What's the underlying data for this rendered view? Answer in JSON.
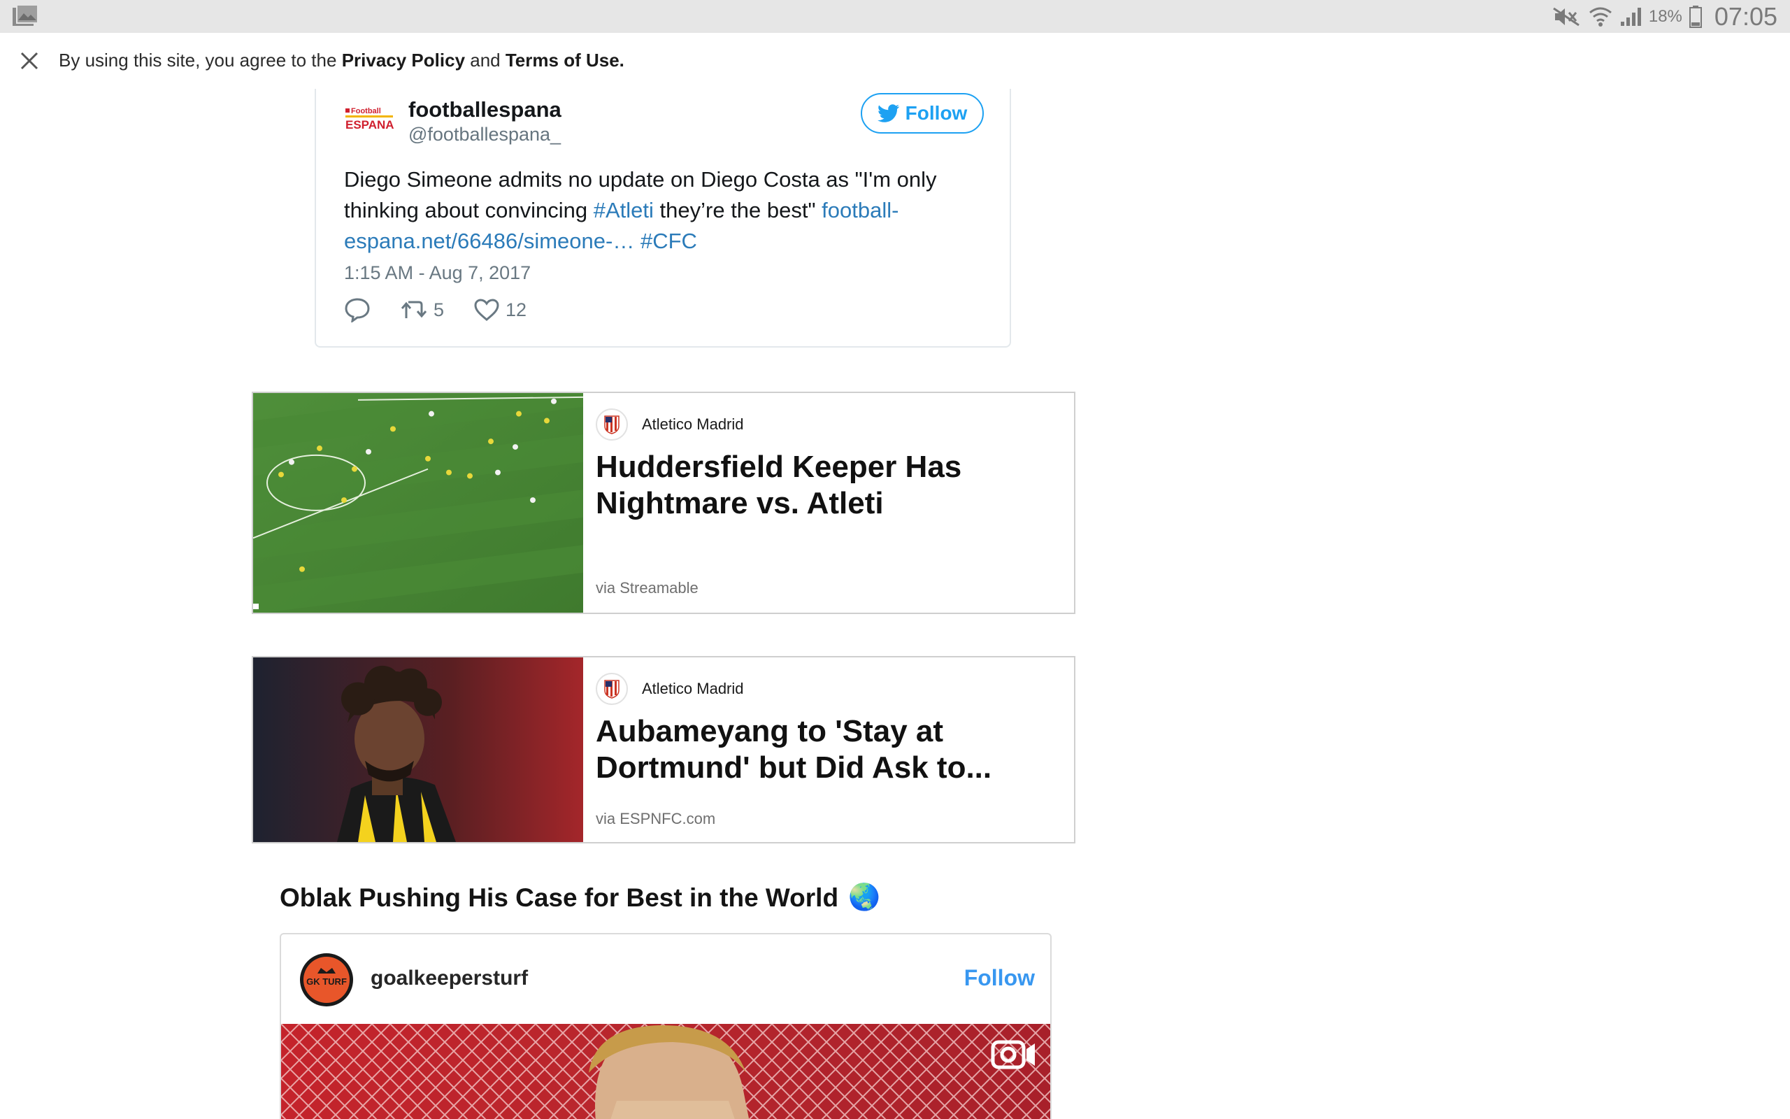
{
  "status_bar": {
    "battery": "18%",
    "time": "07:05"
  },
  "banner": {
    "prefix": "By using this site, you agree to the ",
    "privacy": "Privacy Policy",
    "and": " and ",
    "terms": "Terms of Use."
  },
  "tweet": {
    "logo_top": "Football",
    "logo_bottom": "ESPANA",
    "name": "footballespana",
    "handle": "@footballespana_",
    "follow_label": "Follow",
    "text_1": "Diego Simeone admits no update on Diego Costa as \"I'm only thinking about convincing ",
    "hashtag_1": "#Atleti",
    "text_2": " they’re the best\" ",
    "link": "football-espana.net/66486/simeone-…",
    "text_3": " ",
    "hashtag_2": "#CFC",
    "time": "1:15 AM - Aug 7, 2017",
    "retweets": "5",
    "likes": "12"
  },
  "articles": [
    {
      "source": "Atletico Madrid",
      "title": "Huddersfield Keeper Has Nightmare vs. Atleti",
      "via": "via Streamable"
    },
    {
      "source": "Atletico Madrid",
      "title": "Aubameyang to 'Stay at Dortmund' but Did Ask to...",
      "via": "via ESPNFC.com"
    }
  ],
  "section": {
    "heading": "Oblak Pushing His Case for Best in the World",
    "emoji": "🌏"
  },
  "instagram": {
    "avatar_text": "GK TURF",
    "username": "goalkeepersturf",
    "follow_label": "Follow"
  },
  "colors": {
    "twitter_blue": "#1da1f2",
    "link_blue": "#2b7bb9",
    "instagram_blue": "#3897f0",
    "status_bar_bg": "#e6e6e6"
  },
  "icons": {
    "status_left": "gallery-notification-icon",
    "mute": "mute-icon",
    "wifi": "wifi-icon",
    "signal": "signal-icon",
    "battery": "battery-icon",
    "close": "close-icon",
    "twitter": "twitter-bird-icon",
    "reply": "reply-icon",
    "retweet": "retweet-icon",
    "like": "heart-icon",
    "video": "video-camera-icon"
  }
}
